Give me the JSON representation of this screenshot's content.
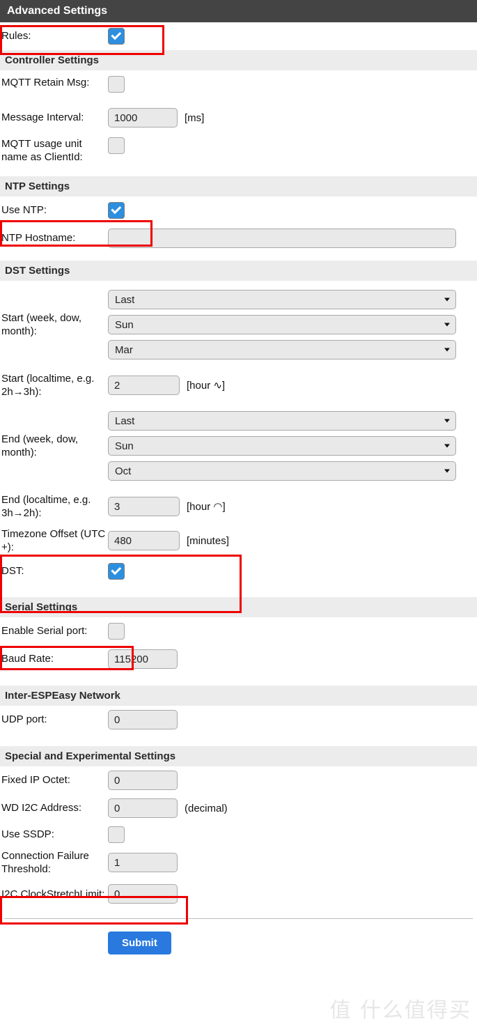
{
  "header": {
    "title": "Advanced Settings"
  },
  "rules": {
    "label": "Rules:",
    "checked": true
  },
  "controller": {
    "section_title": "Controller Settings",
    "mqtt_retain_label": "MQTT Retain Msg:",
    "mqtt_retain_checked": false,
    "message_interval_label": "Message Interval:",
    "message_interval_value": "1000",
    "message_interval_unit": "[ms]",
    "mqtt_clientid_label": "MQTT usage unit name as ClientId:",
    "mqtt_clientid_checked": false
  },
  "ntp": {
    "section_title": "NTP Settings",
    "use_ntp_label": "Use NTP:",
    "use_ntp_checked": true,
    "hostname_label": "NTP Hostname:",
    "hostname_value": "",
    "hostname_placeholder": ""
  },
  "dst": {
    "section_title": "DST Settings",
    "start_wdm_label": "Start (week, dow, month):",
    "start_week": "Last",
    "start_dow": "Sun",
    "start_month": "Mar",
    "start_local_label": "Start (localtime, e.g. 2h→3h):",
    "start_local_value": "2",
    "start_local_unit": "[hour ∿]",
    "end_wdm_label": "End (week, dow, month):",
    "end_week": "Last",
    "end_dow": "Sun",
    "end_month": "Oct",
    "end_local_label": "End (localtime, e.g. 3h→2h):",
    "end_local_value": "3",
    "end_local_unit": "[hour ◠]",
    "tz_offset_label": "Timezone Offset (UTC +):",
    "tz_offset_value": "480",
    "tz_offset_unit": "[minutes]",
    "dst_label": "DST:",
    "dst_checked": true
  },
  "serial": {
    "section_title": "Serial Settings",
    "enable_label": "Enable Serial port:",
    "enable_checked": false,
    "baud_label": "Baud Rate:",
    "baud_value": "115200"
  },
  "network": {
    "section_title": "Inter-ESPEasy Network",
    "udp_label": "UDP port:",
    "udp_value": "0"
  },
  "special": {
    "section_title": "Special and Experimental Settings",
    "fixed_ip_label": "Fixed IP Octet:",
    "fixed_ip_value": "0",
    "wd_i2c_label": "WD I2C Address:",
    "wd_i2c_value": "0",
    "wd_i2c_unit": "(decimal)",
    "ssdp_label": "Use SSDP:",
    "ssdp_checked": false,
    "conn_fail_label": "Connection Failure Threshold:",
    "conn_fail_value": "1",
    "i2c_clock_label": "I2C ClockStretchLimit:",
    "i2c_clock_value": "0"
  },
  "footer": {
    "submit_label": "Submit",
    "watermark": "值 什么值得买"
  },
  "colors": {
    "header_bg": "#444444",
    "section_bg": "#ececec",
    "accent": "#2979df",
    "checkbox_checked": "#2d8fe0",
    "highlight": "#ee0000"
  }
}
